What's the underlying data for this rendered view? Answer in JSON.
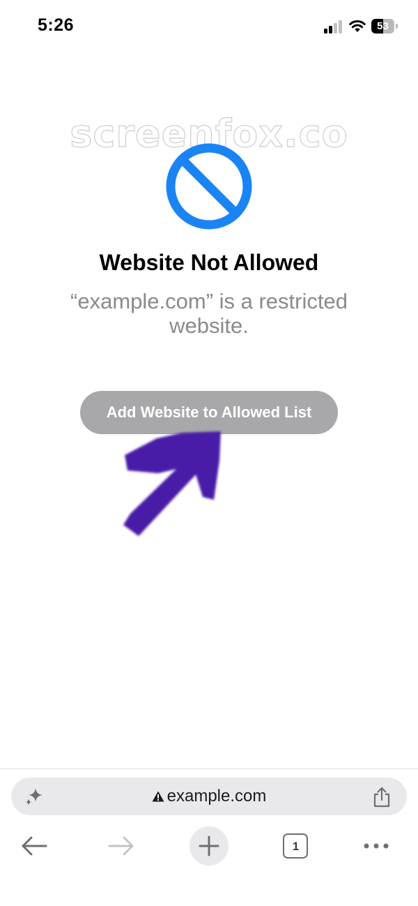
{
  "status_bar": {
    "time": "5:26",
    "battery_level": "53",
    "icons": [
      "cellular-signal-icon",
      "wifi-icon",
      "battery-icon"
    ]
  },
  "watermark": "screenfox.co",
  "page": {
    "icon": "prohibited-icon",
    "title": "Website Not Allowed",
    "subtitle": "“example.com” is a restricted website.",
    "button_label": "Add Website to Allowed List",
    "annotation": "purple-arrow-pointing-to-button"
  },
  "address_bar": {
    "url": "example.com",
    "icons": [
      "sparkle-icon",
      "warning-icon",
      "share-icon"
    ]
  },
  "toolbar": {
    "tab_count": "1",
    "icons": [
      "back-arrow-icon",
      "forward-arrow-icon",
      "plus-icon",
      "tabs-icon",
      "more-icon"
    ]
  },
  "colors": {
    "accent_blue": "#1a84f5",
    "button_gray": "#a8a8aa",
    "subtitle_gray": "#8a8a8e",
    "arrow_purple": "#4a1fa8"
  }
}
